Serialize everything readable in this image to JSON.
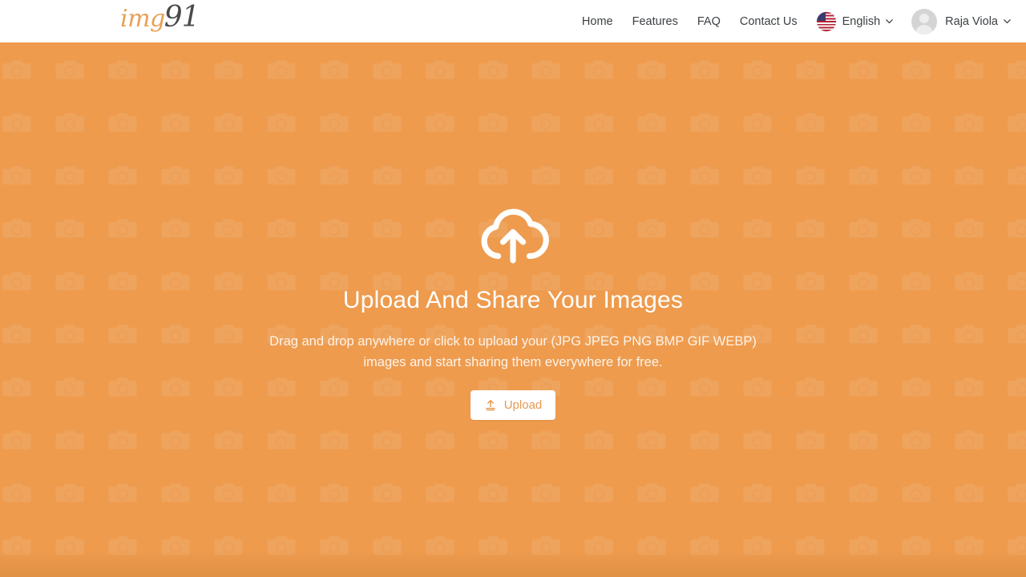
{
  "header": {
    "logo": {
      "part1": "img",
      "part2": "91",
      "name": "img91"
    },
    "nav_links": [
      {
        "label": "Home",
        "name": "nav-link-home"
      },
      {
        "label": "Features",
        "name": "nav-link-features"
      },
      {
        "label": "FAQ",
        "name": "nav-link-faq"
      },
      {
        "label": "Contact Us",
        "name": "nav-link-contact-us"
      }
    ],
    "language": {
      "label": "English",
      "flag_icon": "us-flag-icon",
      "chevron_icon": "chevron-down-icon"
    },
    "user": {
      "name": "Raja Viola",
      "avatar_icon": "user-avatar-icon",
      "chevron_icon": "chevron-down-icon"
    }
  },
  "hero": {
    "cloud_icon": "cloud-upload-icon",
    "title": "Upload And Share Your Images",
    "subtitle_line1": "Drag and drop anywhere or click to upload your (JPG JPEG PNG BMP GIF WEBP)",
    "subtitle_line2": "images and start sharing them everywhere for free.",
    "upload_button": {
      "label": "Upload",
      "icon": "upload-icon"
    },
    "background_pattern_icon": "camera-icon"
  },
  "colors": {
    "brand_orange": "#ee9b4e",
    "logo_orange": "#e8a054",
    "logo_dark": "#4a4a4a",
    "nav_text": "#3c4043",
    "hero_text": "#ffffff",
    "button_bg": "#ffffff",
    "button_text": "#e79a55"
  }
}
